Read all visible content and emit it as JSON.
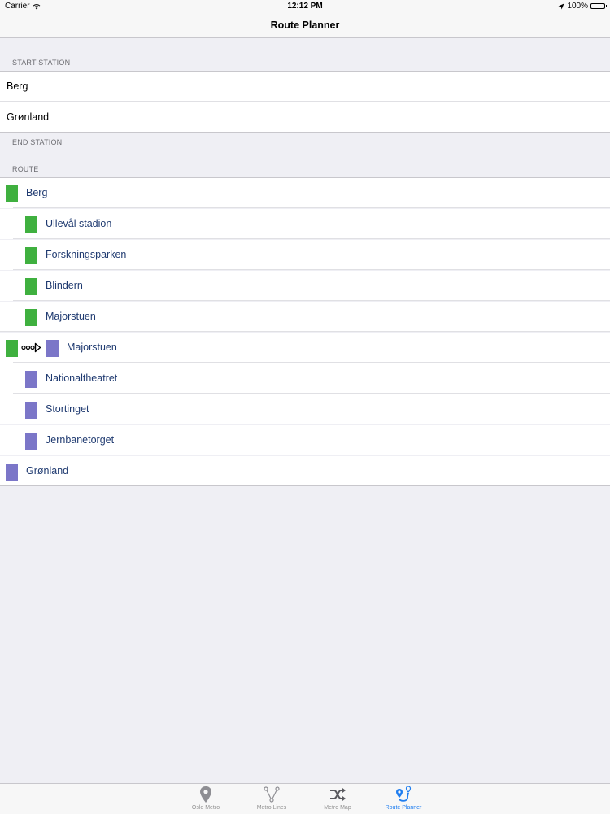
{
  "status_bar": {
    "carrier": "Carrier",
    "time": "12:12 PM",
    "battery": "100%"
  },
  "nav": {
    "title": "Route Planner"
  },
  "sections": {
    "start_station": "START STATION",
    "end_station": "END STATION",
    "route": "ROUTE"
  },
  "inputs": {
    "start_value": "Berg",
    "end_value": "Grønland"
  },
  "route": [
    {
      "label": "Berg",
      "color": "#3fb03f"
    },
    {
      "label": "Ullevål stadion",
      "color": "#3fb03f"
    },
    {
      "label": "Forskningsparken",
      "color": "#3fb03f"
    },
    {
      "label": "Blindern",
      "color": "#3fb03f"
    },
    {
      "label": "Majorstuen",
      "color": "#3fb03f"
    },
    {
      "label": "Majorstuen",
      "color": "#7b76c8",
      "transfer_from": "#3fb03f",
      "icon": "transfer-arrow-icon"
    },
    {
      "label": "Nationaltheatret",
      "color": "#7b76c8"
    },
    {
      "label": "Stortinget",
      "color": "#7b76c8"
    },
    {
      "label": "Jernbanetorget",
      "color": "#7b76c8"
    },
    {
      "label": "Grønland",
      "color": "#7b76c8"
    }
  ],
  "tabs": [
    {
      "label": "Oslo Metro",
      "icon": "map-pin-icon",
      "active": false
    },
    {
      "label": "Metro Lines",
      "icon": "network-icon",
      "active": false
    },
    {
      "label": "Metro Map",
      "icon": "shuffle-icon",
      "active": false
    },
    {
      "label": "Route Planner",
      "icon": "route-icon",
      "active": true
    }
  ],
  "colors": {
    "accent": "#1e7df0",
    "route_text": "#1f3a70",
    "line_green": "#3fb03f",
    "line_purple": "#7b76c8"
  }
}
